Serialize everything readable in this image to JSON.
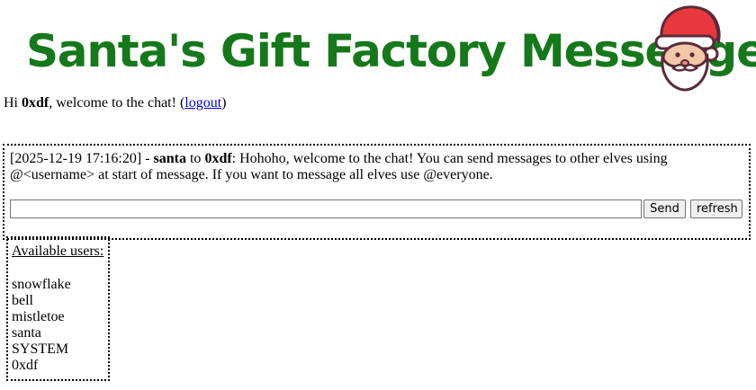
{
  "header": {
    "title": "Santa's Gift Factory Messenger",
    "logo_icon": "santa-face-icon"
  },
  "welcome": {
    "prefix": "Hi ",
    "username": "0xdf",
    "suffix": ", welcome to the chat! (",
    "logout_label": "logout",
    "close": ")"
  },
  "chat": {
    "messages": [
      {
        "timestamp": "[2025-12-19 17:16:20]",
        "sep": " - ",
        "from": "santa",
        "to_word": " to ",
        "to": "0xdf",
        "text": ": Hohoho, welcome to the chat! You can send messages to other elves using @<username> at start of message. If you want to message all elves use @everyone."
      }
    ],
    "input_value": "",
    "send_label": "Send",
    "refresh_label": "refresh"
  },
  "users": {
    "title": "Available users:",
    "list": [
      "snowflake",
      "bell",
      "mistletoe",
      "santa",
      "SYSTEM",
      "0xdf"
    ]
  },
  "colors": {
    "title_green": "#15781a",
    "link_blue": "#0000ee",
    "santa_hat_red": "#e8383d"
  }
}
